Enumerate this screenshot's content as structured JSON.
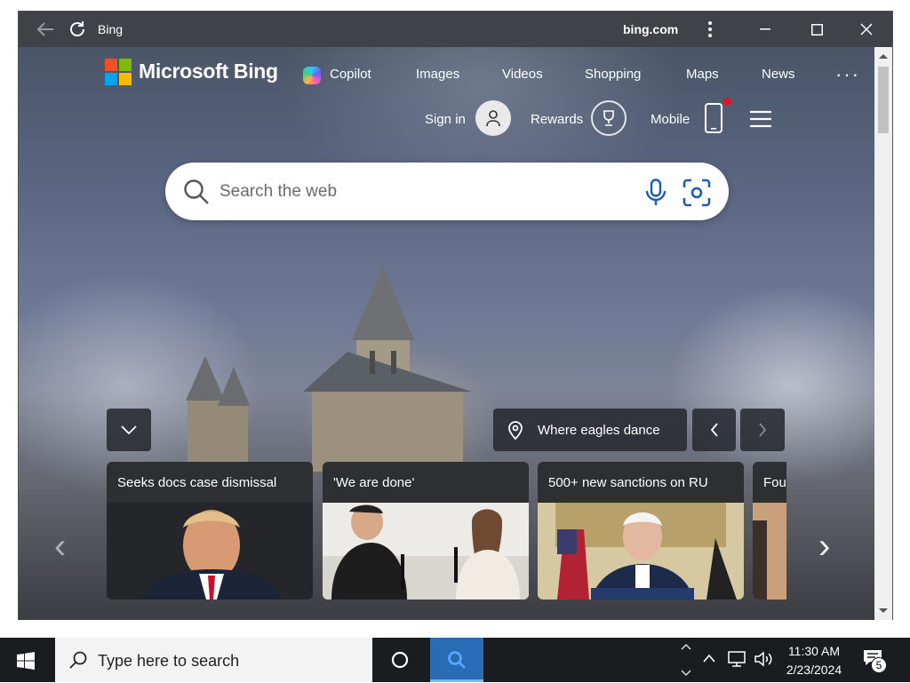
{
  "window": {
    "title": "Bing",
    "domain": "bing.com"
  },
  "header": {
    "logo_text": "Microsoft Bing",
    "nav_items": [
      {
        "label": "Copilot"
      },
      {
        "label": "Images"
      },
      {
        "label": "Videos"
      },
      {
        "label": "Shopping"
      },
      {
        "label": "Maps"
      },
      {
        "label": "News"
      }
    ],
    "more_label": "···",
    "sign_in_label": "Sign in",
    "rewards_label": "Rewards",
    "mobile_label": "Mobile"
  },
  "search": {
    "placeholder": "Search the web"
  },
  "carousel": {
    "location_label": "Where eagles dance",
    "cards": [
      {
        "title": "Seeks docs case dismissal"
      },
      {
        "title": "'We are done'"
      },
      {
        "title": "500+ new sanctions on RU"
      },
      {
        "title": "Fou"
      }
    ]
  },
  "taskbar": {
    "search_placeholder": "Type here to search",
    "time": "11:30 AM",
    "date": "2/23/2024",
    "notification_count": "5"
  },
  "colors": {
    "logo_red": "#f25022",
    "logo_green": "#7fba00",
    "logo_blue": "#00a4ef",
    "logo_yellow": "#ffb900",
    "notification_dot": "#e81123",
    "taskbar_active": "#2a6bb5"
  }
}
